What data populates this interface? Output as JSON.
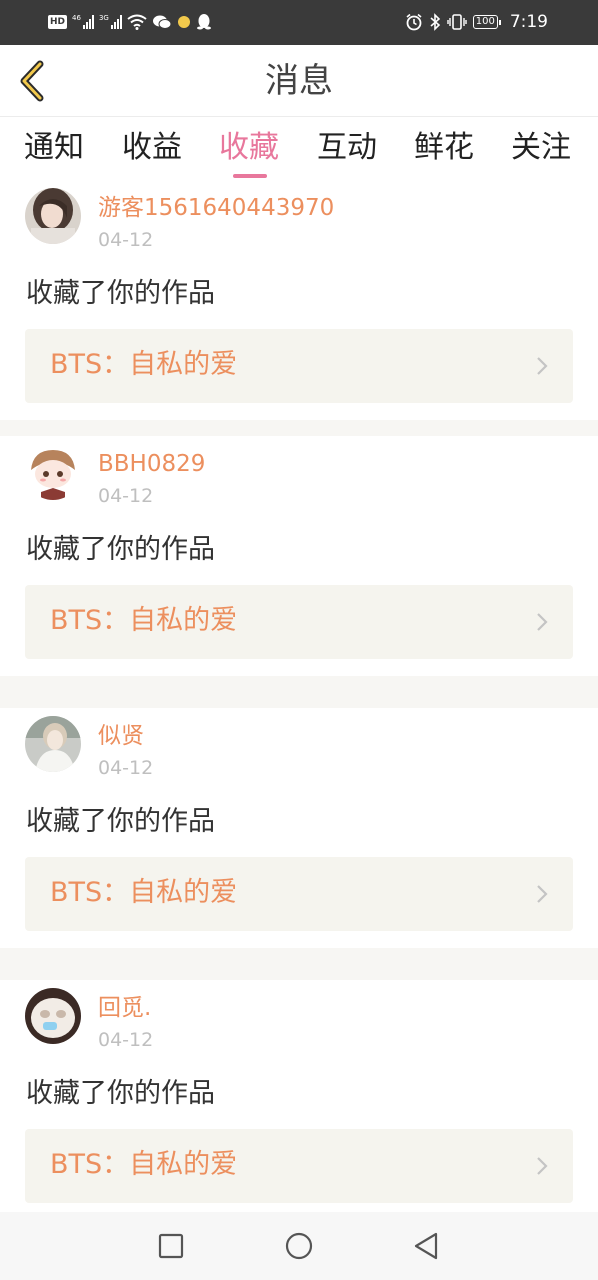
{
  "status_bar": {
    "left_tags": [
      "HD",
      "46",
      "3G"
    ],
    "time": "7:19",
    "battery": "100"
  },
  "header": {
    "title": "消息",
    "back_icon": "chevron-left-icon"
  },
  "tabs": [
    {
      "label": "通知",
      "active": false
    },
    {
      "label": "收益",
      "active": false
    },
    {
      "label": "收藏",
      "active": true
    },
    {
      "label": "互动",
      "active": false
    },
    {
      "label": "鲜花",
      "active": false
    },
    {
      "label": "关注",
      "active": false
    }
  ],
  "items": [
    {
      "username": "游客1561640443970",
      "date": "04-12",
      "action": "收藏了你的作品",
      "work_title": "BTS：自私的爱"
    },
    {
      "username": "BBH0829",
      "date": "04-12",
      "action": "收藏了你的作品",
      "work_title": "BTS：自私的爱"
    },
    {
      "username": "似贤",
      "date": "04-12",
      "action": "收藏了你的作品",
      "work_title": "BTS：自私的爱"
    },
    {
      "username": "回觅.",
      "date": "04-12",
      "action": "收藏了你的作品",
      "work_title": "BTS：自私的爱"
    }
  ],
  "nav_bar": {
    "icons": [
      "square-icon",
      "circle-icon",
      "triangle-back-icon"
    ]
  },
  "colors": {
    "accent": "#e8779c",
    "username": "#ec8f5e",
    "link_bg": "#f5f4ee"
  }
}
